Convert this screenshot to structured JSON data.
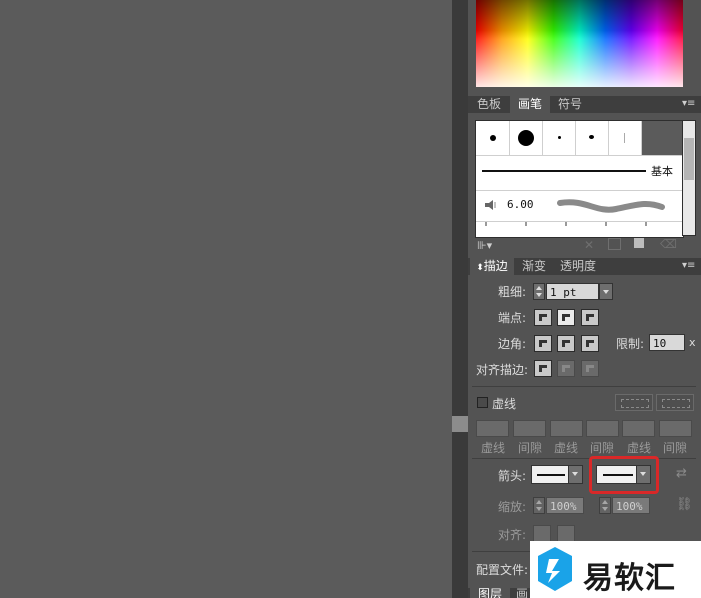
{
  "swatch_tabs": [
    "色板",
    "画笔",
    "符号"
  ],
  "brush_panel": {
    "basic_label": "基本",
    "size_value": "6.00"
  },
  "stroke_tabs": [
    "描边",
    "渐变",
    "透明度"
  ],
  "stroke": {
    "weight_label": "粗细:",
    "weight_value": "1 pt",
    "cap_label": "端点:",
    "corner_label": "边角:",
    "limit_label": "限制:",
    "limit_value": "10",
    "limit_unit": "x",
    "align_label": "对齐描边:",
    "dashed_label": "虚线",
    "dash_labels": [
      "虚线",
      "间隙",
      "虚线",
      "间隙",
      "虚线",
      "间隙"
    ],
    "arrow_label": "箭头:",
    "scale_label": "缩放:",
    "scale_start": "100%",
    "scale_end": "100%",
    "align2_label": "对齐:",
    "profile_label": "配置文件:"
  },
  "bottom_tabs": [
    "图层",
    "画"
  ],
  "watermark_text": "易软汇",
  "colors": {
    "canvas": "#5b5b5b",
    "panel": "#535353",
    "highlight": "#d92828",
    "watermark_blue": "#1aa3e8"
  }
}
